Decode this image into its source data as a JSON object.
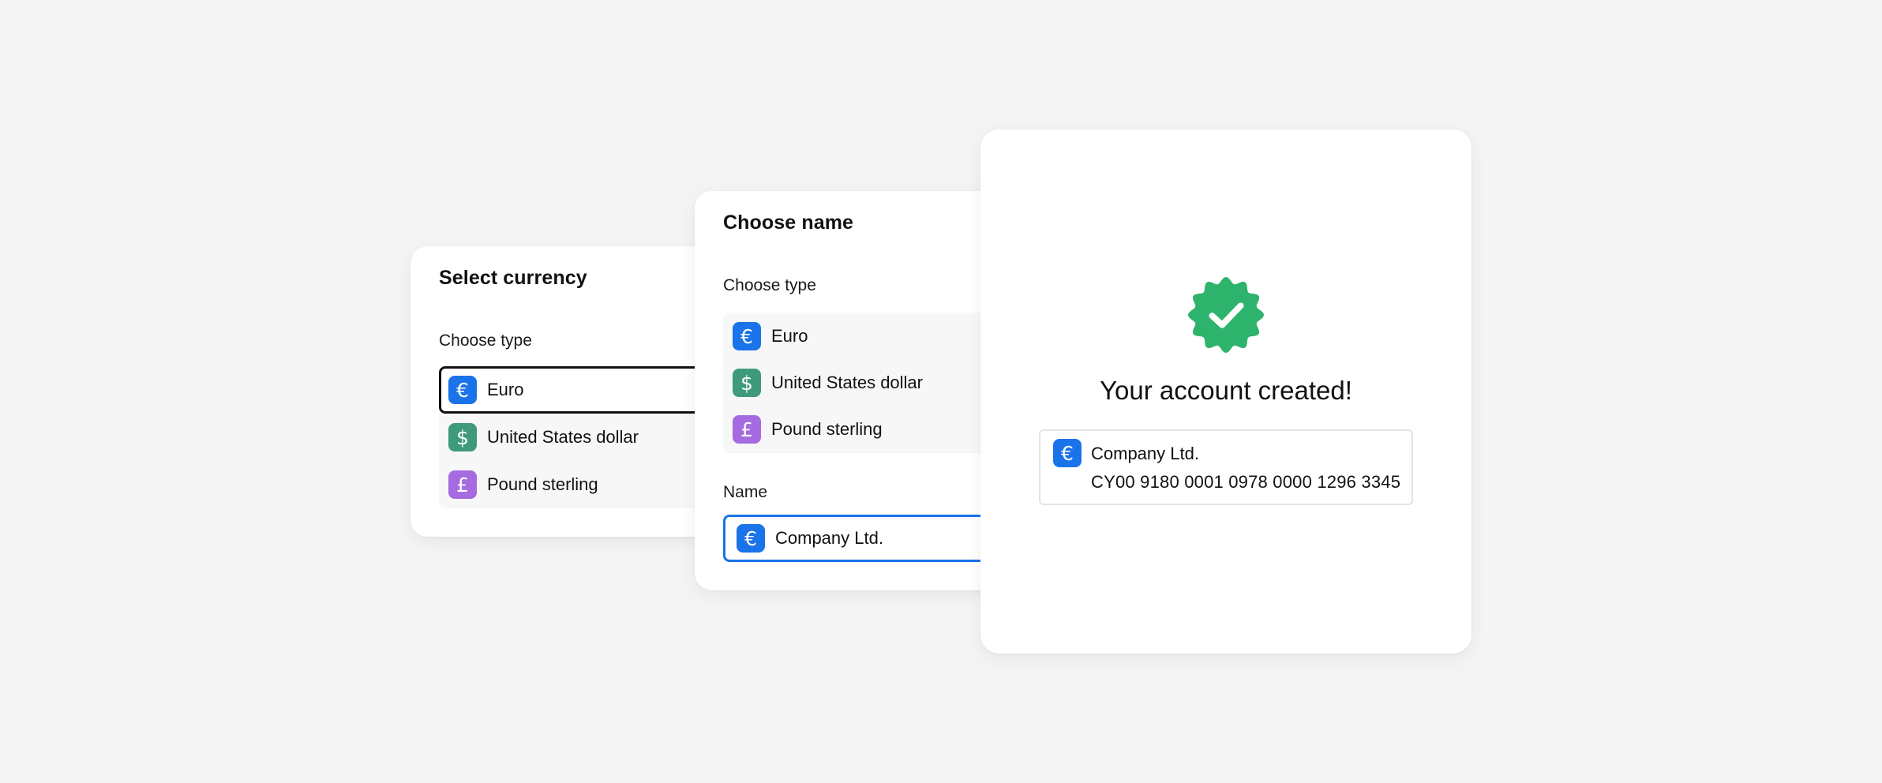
{
  "colors": {
    "euro": "#1a73e8",
    "dollar": "#3e9a7a",
    "pound": "#a66be0",
    "success": "#2db36b",
    "focus": "#1a73e8"
  },
  "step1": {
    "title": "Select currency",
    "type_label": "Choose type",
    "options": [
      {
        "label": "Euro",
        "symbol": "€",
        "icon": "euro-icon"
      },
      {
        "label": "United States dollar",
        "symbol": "$",
        "icon": "dollar-icon"
      },
      {
        "label": "Pound sterling",
        "symbol": "£",
        "icon": "pound-icon"
      }
    ]
  },
  "step2": {
    "title": "Choose name",
    "type_label": "Choose type",
    "options": [
      {
        "label": "Euro",
        "symbol": "€",
        "icon": "euro-icon"
      },
      {
        "label": "United States dollar",
        "symbol": "$",
        "icon": "dollar-icon"
      },
      {
        "label": "Pound sterling",
        "symbol": "£",
        "icon": "pound-icon"
      }
    ],
    "name_label": "Name",
    "name_value": "Company Ltd.",
    "name_symbol": "€"
  },
  "step3": {
    "message": "Your account created!",
    "account": {
      "symbol": "€",
      "name": "Company Ltd.",
      "iban": "CY00 9180 0001 0978 0000 1296 3345"
    }
  }
}
